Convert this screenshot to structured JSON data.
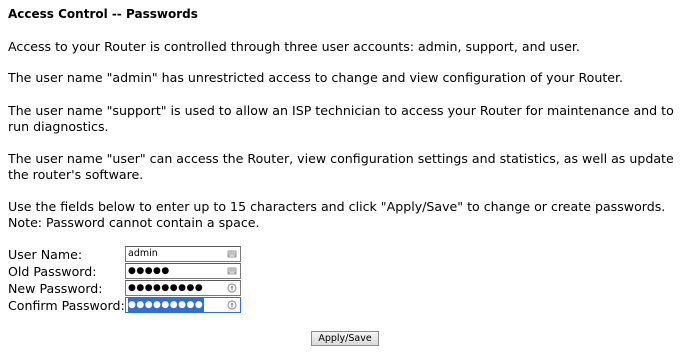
{
  "section_title": "Access Control -- Passwords",
  "paragraphs": {
    "p1": "Access to your Router is controlled through three user accounts: admin, support, and user.",
    "p2": "The user name \"admin\" has unrestricted access to change and view configuration of your Router.",
    "p3": "The user name \"support\" is used to allow an ISP technician to access your Router for maintenance and to run diagnostics.",
    "p4": "The user name \"user\" can access the Router, view configuration settings and statistics, as well as update the router's software.",
    "p5_line1": "Use the fields below to enter up to 15 characters and click \"Apply/Save\" to change or create passwords.",
    "p5_line2": "Note: Password cannot contain a space."
  },
  "form": {
    "username": {
      "label": "User Name:",
      "value": "admin"
    },
    "old_password": {
      "label": "Old Password:",
      "masked": "●●●●●"
    },
    "new_password": {
      "label": "New Password:",
      "masked": "●●●●●●●●●"
    },
    "confirm_password": {
      "label": "Confirm Password:",
      "masked": "●●●●●●●●●"
    }
  },
  "buttons": {
    "apply_save": "Apply/Save"
  },
  "icons": {
    "username_field": "keyboard-icon",
    "old_password_field": "keyboard-icon",
    "new_password_field": "key-icon",
    "confirm_password_field": "key-icon"
  },
  "colors": {
    "selection": "#2f6fd8"
  }
}
